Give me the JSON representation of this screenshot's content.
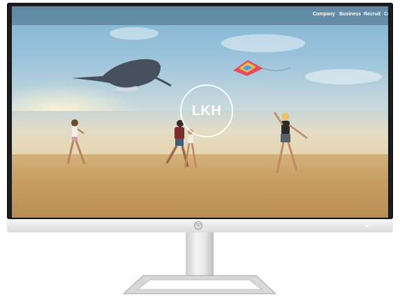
{
  "nav": {
    "items": [
      "Company",
      "Business",
      "Recruit",
      "Co"
    ]
  },
  "hero": {
    "logo_text": "LKH"
  },
  "device": {
    "brand_mark": "hp"
  },
  "colors": {
    "nav_text": "#ffffff",
    "bezel": "#1b1c1f",
    "chin": "#e6e6e6"
  }
}
